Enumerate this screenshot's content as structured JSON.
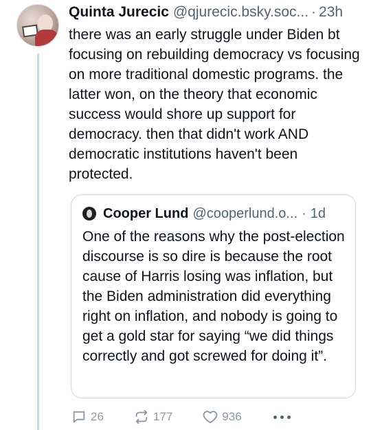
{
  "post": {
    "display_name": "Quinta Jurecic",
    "handle": "@qjurecic.bsky.soc...",
    "separator": "·",
    "time": "23h",
    "text": "there was an early struggle under Biden bt focusing on rebuilding democracy vs focusing on more traditional domestic programs. the latter won, on the theory that economic success would shore up support for democracy. then that didn't work AND democratic institutions haven't been protected."
  },
  "quote": {
    "display_name": "Cooper Lund",
    "handle": "@cooperlund.o...",
    "separator": "·",
    "time": "1d",
    "text": "One of the reasons why the post-election discourse is so dire is because the root cause of Harris losing was inflation, but the Biden administration did everything right on inflation, and nobody is going to get a gold star for saying “we did things correctly and got screwed for doing it”."
  },
  "actions": {
    "replies": "26",
    "reposts": "177",
    "likes": "936",
    "more_icon": "ellipsis-icon"
  },
  "colors": {
    "text": "#0f1419",
    "muted": "#536471",
    "border": "#cfd9de",
    "icon": "#8b98a5"
  }
}
